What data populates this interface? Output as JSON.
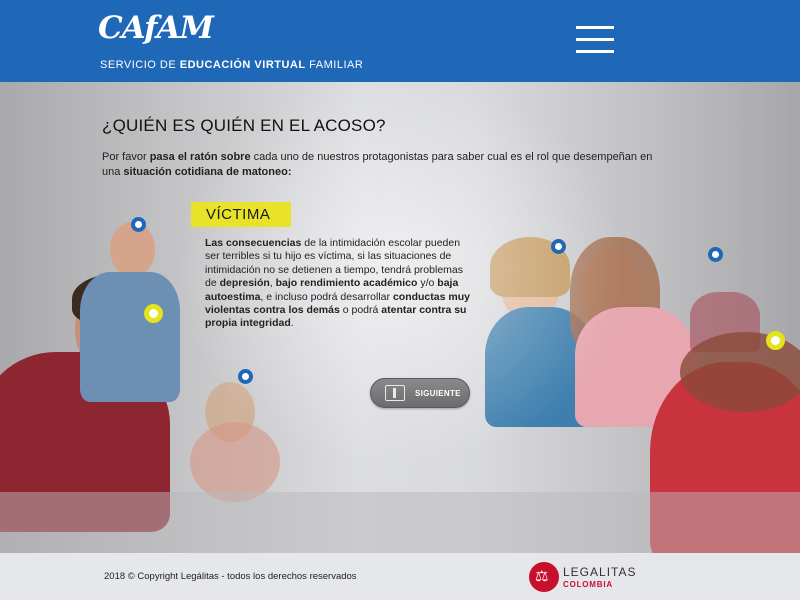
{
  "header": {
    "logo_text": "CAfAM",
    "tagline_pre": "SERVICIO DE ",
    "tagline_bold": "EDUCACIÓN VIRTUAL",
    "tagline_post": " FAMILIAR",
    "menu_icon": "hamburger-menu-icon"
  },
  "main": {
    "title": "¿QUIÉN ES QUIÉN EN EL ACOSO?",
    "intro": {
      "t1": "Por favor ",
      "b1": "pasa el ratón sobre",
      "t2": " cada uno de nuestros protagonistas para saber cual es el rol que desempeñan en una ",
      "b2": "situación cotidiana de matoneo:"
    },
    "role": {
      "label": "VÍCTIMA",
      "b1": "Las consecuencias",
      "t1": " de la intimidación escolar pueden ser terribles si tu hijo es víctima, si las situaciones de intimidación no se detienen a tiempo, tendrá problemas de ",
      "b2": "depresión",
      "t2": ", ",
      "b3": "bajo rendimiento académico",
      "t3": " y/o ",
      "b4": "baja autoestima",
      "t4": ", e incluso podrá desarrollar ",
      "b5": "conductas muy violentas contra los demás",
      "t5": " o podrá ",
      "b6": "atentar contra su propia integridad",
      "t6": "."
    },
    "next_button": {
      "label": "SIGUIENTE",
      "icon": "book-icon"
    },
    "hotspots": [
      {
        "color": "blue"
      },
      {
        "color": "yellow"
      },
      {
        "color": "blue"
      },
      {
        "color": "blue"
      },
      {
        "color": "blue"
      },
      {
        "color": "yellow"
      }
    ],
    "colors": {
      "brand_blue": "#1f68b8",
      "highlight_yellow": "#e8e22b",
      "legalitas_red": "#c8102e"
    }
  },
  "footer": {
    "copyright": "2018 © Copyright Legálitas - todos los derechos reservados",
    "partner_name": "LEGALITAS",
    "partner_sub": "COLOMBIA"
  }
}
